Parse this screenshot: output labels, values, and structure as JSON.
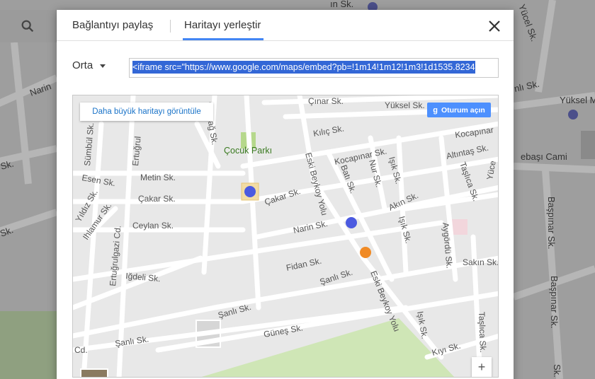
{
  "tabs": {
    "share_label": "Bağlantıyı paylaş",
    "embed_label": "Haritayı yerleştir",
    "active": "embed"
  },
  "size_select": {
    "value": "Orta"
  },
  "embed_code": {
    "value": "<iframe src=\"https://www.google.com/maps/embed?pb=!1m14!1m12!1m3!1d1535.8234"
  },
  "preview": {
    "bigger_map_label": "Daha büyük haritayı görüntüle",
    "signin_label": "Oturum açın",
    "signin_g": "g",
    "zoom_in_label": "+",
    "streets": [
      {
        "label": "Çınar Sk."
      },
      {
        "label": "Yüksel Sk."
      },
      {
        "label": "Kılıç Sk."
      },
      {
        "label": "Kocapınar Sk."
      },
      {
        "label": "Kocapınar"
      },
      {
        "label": "Altıntaş Sk."
      },
      {
        "label": "Çocuk Parkı"
      },
      {
        "label": "Metin Sk."
      },
      {
        "label": "Çakar Sk."
      },
      {
        "label": "Çakar Sk."
      },
      {
        "label": "Esen Sk."
      },
      {
        "label": "Ceylan Sk."
      },
      {
        "label": "Narin Sk."
      },
      {
        "label": "Fidan Sk."
      },
      {
        "label": "Iğdeli Sk."
      },
      {
        "label": "Şanlı Sk."
      },
      {
        "label": "Şanlı Sk."
      },
      {
        "label": "Şanlı Sk."
      },
      {
        "label": "Güneş Sk."
      },
      {
        "label": "Kıyı Sk."
      },
      {
        "label": "Sakın Sk."
      },
      {
        "label": "Akın Sk."
      },
      {
        "label": "Eski Beykoy Yolu"
      },
      {
        "label": "Eski Beykoy Yolu"
      },
      {
        "label": "Batı Sk."
      },
      {
        "label": "Nur Sk."
      },
      {
        "label": "Işık Sk."
      },
      {
        "label": "Işık Sk."
      },
      {
        "label": "Işık Sk."
      },
      {
        "label": "Taşlıca Sk."
      },
      {
        "label": "Taşlıca Sk."
      },
      {
        "label": "Aygördü Sk."
      },
      {
        "label": "Kutluağ Sk."
      },
      {
        "label": "Ertuğrulgazi Cd."
      },
      {
        "label": "Ertuğrul"
      },
      {
        "label": "Sümbül Sk."
      },
      {
        "label": "Yıldız Sk."
      },
      {
        "label": "Ihlamur Sk."
      },
      {
        "label": "Cd."
      },
      {
        "label": "Yüce"
      }
    ]
  },
  "background": {
    "labels": [
      {
        "label": "Narin"
      },
      {
        "label": "Sk."
      },
      {
        "label": "Sk."
      },
      {
        "label": "Yüksel M"
      },
      {
        "label": "ebaşı Cami"
      },
      {
        "label": "Başpınar Sk."
      },
      {
        "label": "Başpınar Sk."
      },
      {
        "label": "Sk."
      },
      {
        "label": "Yücel Sk."
      },
      {
        "label": "nlı Sk."
      },
      {
        "label": "ın Sk."
      }
    ]
  }
}
